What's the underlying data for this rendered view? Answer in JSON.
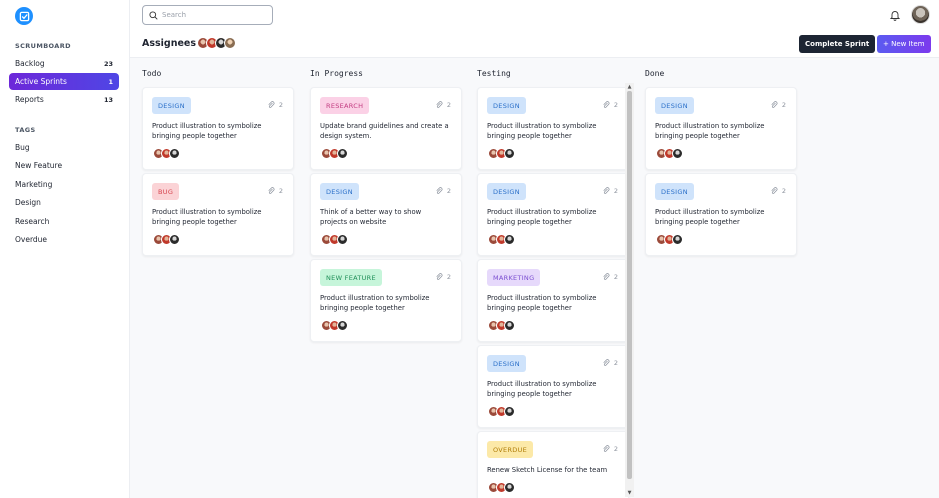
{
  "sidebar": {
    "section_title": "SCRUMBOARD",
    "items": [
      {
        "label": "Backlog",
        "count": "23",
        "active": false
      },
      {
        "label": "Active Sprints",
        "count": "1",
        "active": true
      },
      {
        "label": "Reports",
        "count": "13",
        "active": false
      }
    ],
    "tags_title": "TAGS",
    "tags": [
      "Bug",
      "New Feature",
      "Marketing",
      "Design",
      "Research",
      "Overdue"
    ]
  },
  "header": {
    "search_placeholder": "Search",
    "assignees_title": "Assignees",
    "complete_label": "Complete Sprint",
    "new_item_label": "+ New Item"
  },
  "columns": [
    {
      "title": "Todo",
      "cards": [
        {
          "tag": "DESIGN",
          "tag_class": "b-design",
          "attachments": "2",
          "text": "Product illustration to symbolize bringing people together"
        },
        {
          "tag": "BUG",
          "tag_class": "b-bug",
          "attachments": "2",
          "text": "Product illustration to symbolize bringing people together"
        }
      ]
    },
    {
      "title": "In Progress",
      "cards": [
        {
          "tag": "RESEARCH",
          "tag_class": "b-research",
          "attachments": "2",
          "text": "Update brand guidelines and create a design system."
        },
        {
          "tag": "DESIGN",
          "tag_class": "b-design",
          "attachments": "2",
          "text": "Think of a better way to show projects on website"
        },
        {
          "tag": "NEW FEATURE",
          "tag_class": "b-newfeature",
          "attachments": "2",
          "text": "Product illustration to symbolize bringing people together"
        }
      ]
    },
    {
      "title": "Testing",
      "cards": [
        {
          "tag": "DESIGN",
          "tag_class": "b-design",
          "attachments": "2",
          "text": "Product illustration to symbolize bringing people together"
        },
        {
          "tag": "DESIGN",
          "tag_class": "b-design",
          "attachments": "2",
          "text": "Product illustration to symbolize bringing people together"
        },
        {
          "tag": "MARKETING",
          "tag_class": "b-marketing",
          "attachments": "2",
          "text": "Product illustration to symbolize bringing people together"
        },
        {
          "tag": "DESIGN",
          "tag_class": "b-design",
          "attachments": "2",
          "text": "Product illustration to symbolize bringing people together"
        },
        {
          "tag": "OVERDUE",
          "tag_class": "b-overdue",
          "attachments": "2",
          "text": "Renew Sketch License for the team"
        }
      ]
    },
    {
      "title": "Done",
      "cards": [
        {
          "tag": "DESIGN",
          "tag_class": "b-design",
          "attachments": "2",
          "text": "Product illustration to symbolize bringing people together"
        },
        {
          "tag": "DESIGN",
          "tag_class": "b-design",
          "attachments": "2",
          "text": "Product illustration to symbolize bringing people together"
        }
      ]
    }
  ],
  "icons": {
    "logo": "checkbox-logo-icon",
    "search": "search-icon",
    "bell": "bell-icon",
    "attach": "paperclip-icon"
  },
  "colors": {
    "accent": "#5b5bf0",
    "active_nav": "#6d28d9",
    "dark_button": "#1d2533",
    "logo": "#1e90ff"
  }
}
